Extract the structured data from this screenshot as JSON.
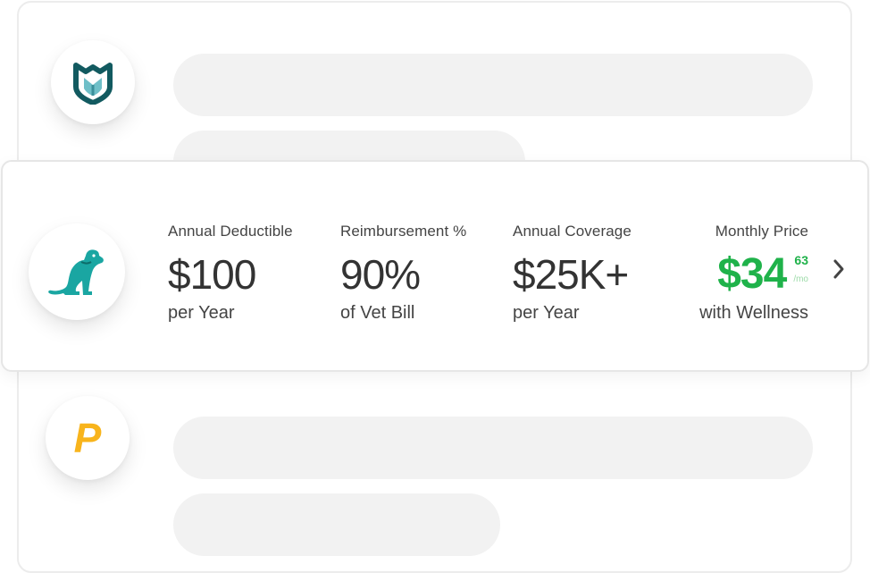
{
  "plans": [
    {
      "logo_icon": "shield-heart-logo-icon",
      "placeholder": true
    },
    {
      "logo_icon": "dog-logo-icon",
      "deductible": {
        "label": "Annual Deductible",
        "value": "$100",
        "sub": "per Year"
      },
      "reimbursement": {
        "label": "Reimbursement %",
        "value": "90%",
        "sub": "of Vet Bill"
      },
      "coverage": {
        "label": "Annual Coverage",
        "value": "$25K+",
        "sub": "per Year"
      },
      "price": {
        "label": "Monthly Price",
        "dollars": "$34",
        "cents": "63",
        "unit": "/mo",
        "sub": "with Wellness"
      },
      "chevron_icon": "chevron-right-icon"
    },
    {
      "logo_icon": "letter-p-logo-icon",
      "logo_letter": "P",
      "placeholder": true
    }
  ],
  "colors": {
    "price_green": "#1fb24a",
    "teal": "#1aa6a2",
    "dark_teal": "#125a60",
    "logo_yellow": "#f8b41c",
    "skeleton": "#f2f2f2"
  }
}
